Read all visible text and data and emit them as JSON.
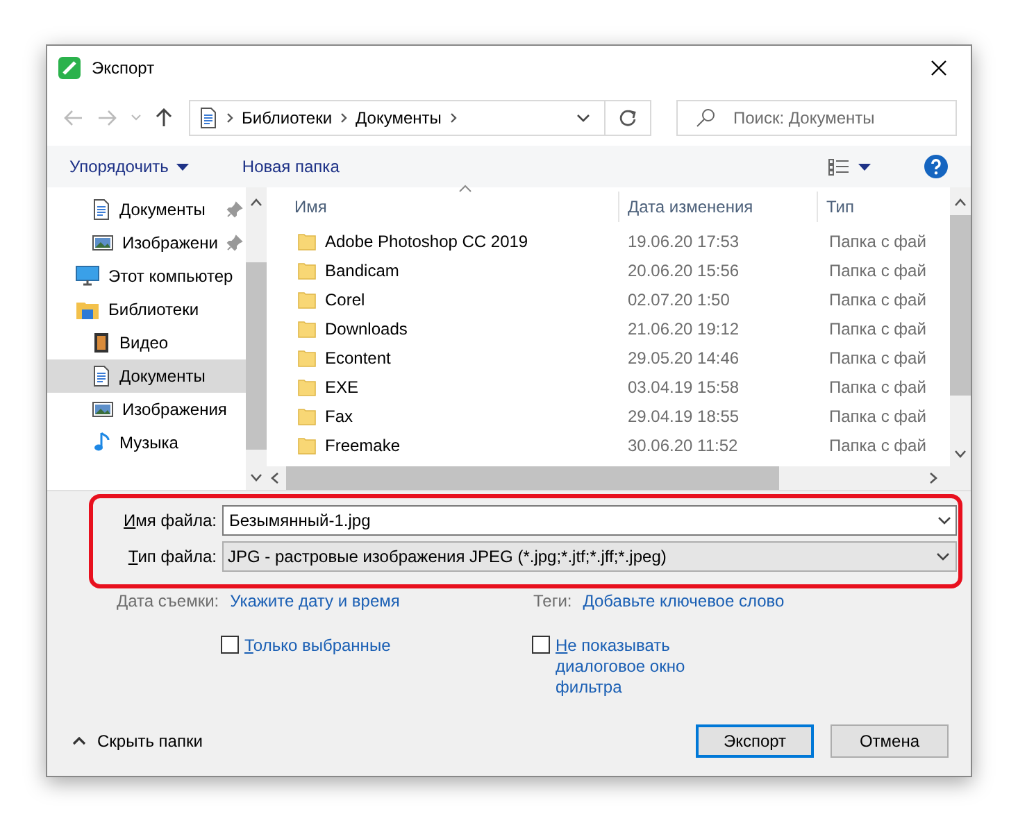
{
  "window": {
    "title": "Экспорт"
  },
  "address": {
    "crumbs": [
      "Библиотеки",
      "Документы"
    ]
  },
  "search": {
    "placeholder": "Поиск: Документы"
  },
  "toolbar": {
    "organize": "Упорядочить",
    "new_folder": "Новая папка"
  },
  "sidebar": {
    "items": [
      {
        "label": "Документы",
        "kind": "document",
        "pinned": true,
        "selected": false
      },
      {
        "label": "Изображени",
        "kind": "image",
        "pinned": true,
        "selected": false
      },
      {
        "label": "Этот компьютер",
        "kind": "computer",
        "pinned": false,
        "selected": false
      },
      {
        "label": "Библиотеки",
        "kind": "library",
        "pinned": false,
        "selected": false,
        "children": [
          {
            "label": "Видео",
            "kind": "video",
            "pinned": false,
            "selected": false
          },
          {
            "label": "Документы",
            "kind": "document",
            "pinned": false,
            "selected": true
          },
          {
            "label": "Изображения",
            "kind": "image",
            "pinned": false,
            "selected": false
          },
          {
            "label": "Музыка",
            "kind": "music",
            "pinned": false,
            "selected": false
          }
        ]
      }
    ]
  },
  "table": {
    "columns": [
      "Имя",
      "Дата изменения",
      "Тип"
    ],
    "rows": [
      [
        "Adobe Photoshop CC 2019",
        "19.06.20 17:53",
        "Папка с фай"
      ],
      [
        "Bandicam",
        "20.06.20 15:56",
        "Папка с фай"
      ],
      [
        "Corel",
        "02.07.20 1:50",
        "Папка с фай"
      ],
      [
        "Downloads",
        "21.06.20 19:12",
        "Папка с фай"
      ],
      [
        "Econtent",
        "29.05.20 14:46",
        "Папка с фай"
      ],
      [
        "EXE",
        "03.04.19 15:58",
        "Папка с фай"
      ],
      [
        "Fax",
        "29.04.19 18:55",
        "Папка с фай"
      ],
      [
        "Freemake",
        "30.06.20 11:52",
        "Папка с фай"
      ]
    ]
  },
  "file_name": {
    "label": "Имя файла:",
    "value": "Безымянный-1.jpg"
  },
  "file_type": {
    "label": "Тип файла:",
    "value": "JPG - растровые изображения JPEG (*.jpg;*.jtf;*.jff;*.jpeg)"
  },
  "meta": [
    {
      "label": "Дата съемки:",
      "link": "Укажите дату и время"
    },
    {
      "label": "Теги:",
      "link": "Добавьте ключевое слово"
    }
  ],
  "options": [
    {
      "label": "Только выбранные",
      "checked": false
    },
    {
      "label": "Не показывать диалоговое окно фильтра",
      "checked": false
    }
  ],
  "hide_folders": "Скрыть папки",
  "buttons": [
    {
      "label": "Экспорт",
      "default": true
    },
    {
      "label": "Отмена",
      "default": false
    }
  ]
}
